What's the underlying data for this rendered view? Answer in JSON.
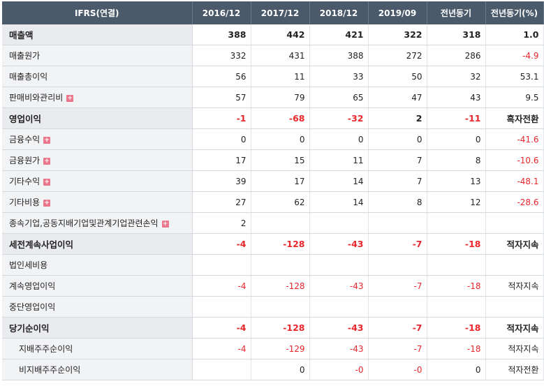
{
  "header": {
    "label": "IFRS(연결)",
    "periods": [
      "2016/12",
      "2017/12",
      "2018/12",
      "2019/09",
      "전년동기",
      "전년동기(%)"
    ]
  },
  "rows": [
    {
      "label": "매출액",
      "bold": true,
      "expand": false,
      "indent": false,
      "values": [
        "388",
        "442",
        "421",
        "322",
        "318",
        "1.0"
      ]
    },
    {
      "label": "매출원가",
      "bold": false,
      "expand": false,
      "indent": false,
      "values": [
        "332",
        "431",
        "388",
        "272",
        "286",
        "-4.9"
      ]
    },
    {
      "label": "매출총이익",
      "bold": false,
      "expand": false,
      "indent": false,
      "values": [
        "56",
        "11",
        "33",
        "50",
        "32",
        "53.1"
      ]
    },
    {
      "label": "판매비와관리비",
      "bold": false,
      "expand": true,
      "indent": false,
      "values": [
        "57",
        "79",
        "65",
        "47",
        "43",
        "9.5"
      ]
    },
    {
      "label": "영업이익",
      "bold": true,
      "expand": false,
      "indent": false,
      "values": [
        "-1",
        "-68",
        "-32",
        "2",
        "-11",
        "흑자전환"
      ]
    },
    {
      "label": "금융수익",
      "bold": false,
      "expand": true,
      "indent": false,
      "values": [
        "0",
        "0",
        "0",
        "0",
        "0",
        "-41.6"
      ]
    },
    {
      "label": "금융원가",
      "bold": false,
      "expand": true,
      "indent": false,
      "values": [
        "17",
        "15",
        "11",
        "7",
        "8",
        "-10.6"
      ]
    },
    {
      "label": "기타수익",
      "bold": false,
      "expand": true,
      "indent": false,
      "values": [
        "39",
        "17",
        "14",
        "7",
        "13",
        "-48.1"
      ]
    },
    {
      "label": "기타비용",
      "bold": false,
      "expand": true,
      "indent": false,
      "values": [
        "27",
        "62",
        "14",
        "8",
        "12",
        "-28.6"
      ]
    },
    {
      "label": "종속기업,공동지배기업및관계기업관련손익",
      "bold": false,
      "expand": true,
      "indent": false,
      "values": [
        "2",
        "",
        "",
        "",
        "",
        ""
      ]
    },
    {
      "label": "세전계속사업이익",
      "bold": true,
      "expand": false,
      "indent": false,
      "values": [
        "-4",
        "-128",
        "-43",
        "-7",
        "-18",
        "적자지속"
      ]
    },
    {
      "label": "법인세비용",
      "bold": false,
      "expand": false,
      "indent": false,
      "values": [
        "",
        "",
        "",
        "",
        "",
        ""
      ]
    },
    {
      "label": "계속영업이익",
      "bold": false,
      "expand": false,
      "indent": false,
      "values": [
        "-4",
        "-128",
        "-43",
        "-7",
        "-18",
        "적자지속"
      ]
    },
    {
      "label": "중단영업이익",
      "bold": false,
      "expand": false,
      "indent": false,
      "values": [
        "",
        "",
        "",
        "",
        "",
        ""
      ]
    },
    {
      "label": "당기순이익",
      "bold": true,
      "expand": false,
      "indent": false,
      "values": [
        "-4",
        "-128",
        "-43",
        "-7",
        "-18",
        "적자지속"
      ]
    },
    {
      "label": "지배주주순이익",
      "bold": false,
      "expand": false,
      "indent": true,
      "values": [
        "-4",
        "-129",
        "-43",
        "-7",
        "-18",
        "적자지속"
      ]
    },
    {
      "label": "비지배주주순이익",
      "bold": false,
      "expand": false,
      "indent": true,
      "values": [
        "",
        "0",
        "-0",
        "-0",
        "0",
        "적자전환"
      ]
    }
  ],
  "colors": {
    "header_bg": "#4b5a6a",
    "negative": "#e8262b",
    "expand_icon": "#e9768a"
  }
}
